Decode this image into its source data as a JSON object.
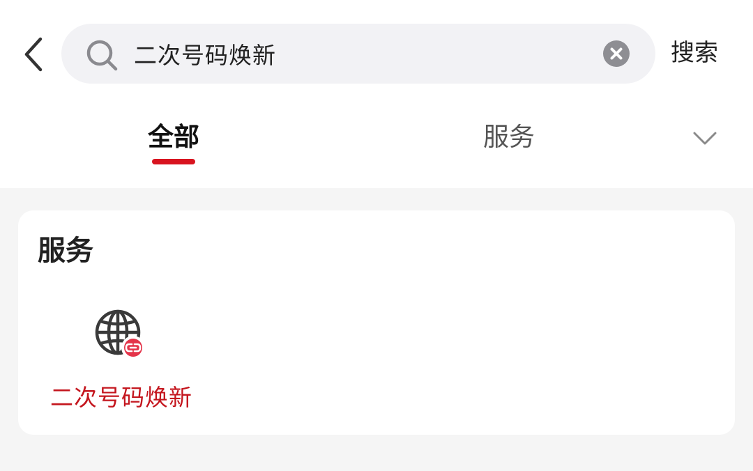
{
  "header": {
    "back_icon": "chevron-left-icon",
    "search_icon": "search-icon",
    "search_value": "二次号码焕新",
    "clear_icon": "clear-circle-icon",
    "search_button": "搜索"
  },
  "tabs": {
    "items": [
      {
        "label": "全部",
        "active": true
      },
      {
        "label": "服务",
        "active": false
      }
    ],
    "expand_icon": "chevron-down-icon",
    "active_color": "#d8141f"
  },
  "results": {
    "section_title": "服务",
    "services": [
      {
        "label": "二次号码焕新",
        "icon": "globe-link-icon"
      }
    ],
    "service_label_color": "#c4161e"
  }
}
